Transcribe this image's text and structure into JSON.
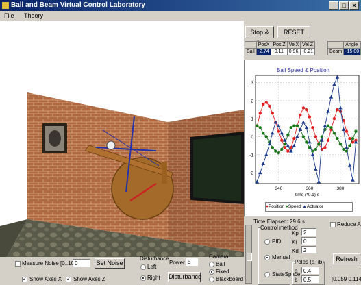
{
  "window": {
    "title": "Ball and Beam Virtual Control Laboratory"
  },
  "menu": {
    "file": "File",
    "theory": "Theory"
  },
  "top_buttons": {
    "stop_go": "Stop & Go",
    "reset": "RESET"
  },
  "state_table": {
    "headers": [
      "PosX",
      "Pos Z",
      "VelX",
      "Vel Z"
    ],
    "row_label": "Ball",
    "values": [
      "-2.74",
      "-0.11",
      "0.96",
      "-0.21"
    ],
    "angle_header": "Angle",
    "angle_row_label": "Beam",
    "angle_value": "-15.00"
  },
  "chart_data": {
    "type": "line",
    "title": "Ball Speed & Position",
    "xlabel": "time (*0.1) s",
    "x_ticks": [
      "340",
      "360",
      "380"
    ],
    "y_ticks": [
      "3",
      "2",
      "1",
      "0",
      "-1",
      "-2"
    ],
    "ylim": [
      -2.6,
      3.4
    ],
    "xlim": [
      325,
      392
    ],
    "legend": [
      "Position",
      "Speed",
      "Actuator"
    ],
    "series": [
      {
        "name": "Position",
        "color": "#e02020",
        "marker": "circle",
        "x": [
          326,
          328,
          330,
          332,
          334,
          336,
          338,
          340,
          342,
          344,
          346,
          348,
          350,
          352,
          354,
          356,
          358,
          360,
          362,
          364,
          366,
          368,
          370,
          372,
          374,
          376,
          378,
          380,
          382,
          384,
          386,
          388,
          390
        ],
        "y": [
          0.6,
          1.3,
          1.8,
          1.9,
          1.7,
          1.3,
          0.8,
          0.3,
          -0.2,
          -0.6,
          -0.8,
          -0.6,
          -0.1,
          0.6,
          1.2,
          1.6,
          1.5,
          1.1,
          0.5,
          0,
          -0.4,
          -0.7,
          -0.6,
          -0.2,
          0.4,
          1.0,
          1.5,
          1.4,
          0.9,
          0.3,
          -0.1,
          -0.3,
          -0.2
        ]
      },
      {
        "name": "Speed",
        "color": "#1a7a1a",
        "marker": "circle",
        "x": [
          326,
          328,
          330,
          332,
          334,
          336,
          338,
          340,
          342,
          344,
          346,
          348,
          350,
          352,
          354,
          356,
          358,
          360,
          362,
          364,
          366,
          368,
          370,
          372,
          374,
          376,
          378,
          380,
          382,
          384,
          386,
          388,
          390
        ],
        "y": [
          0.6,
          0.5,
          0.2,
          0,
          -0.3,
          -0.6,
          -0.8,
          -0.9,
          -0.7,
          -0.4,
          0.1,
          0.5,
          0.6,
          0.6,
          0.4,
          0,
          -0.3,
          -0.6,
          -0.8,
          -0.7,
          -0.4,
          0,
          0.4,
          0.6,
          0.5,
          0.2,
          -0.1,
          -0.4,
          -0.7,
          -0.8,
          -0.5,
          -0.1,
          0.3
        ]
      },
      {
        "name": "Actuator",
        "color": "#1a3a8a",
        "marker": "triangle",
        "x": [
          326,
          328,
          330,
          332,
          334,
          336,
          338,
          340,
          342,
          344,
          346,
          348,
          350,
          352,
          354,
          356,
          358,
          360,
          362,
          364,
          366,
          368,
          370,
          372,
          374,
          376,
          378,
          380,
          382,
          384,
          386,
          388,
          390
        ],
        "y": [
          -2.5,
          -2,
          -1.5,
          -1,
          -0.4,
          0.2,
          0.8,
          0.6,
          0.2,
          -0.2,
          -0.5,
          -0.8,
          -0.5,
          0,
          0.4,
          0.8,
          0.5,
          -0.3,
          -1,
          -1.8,
          -2.5,
          -0.2,
          0.6,
          1.4,
          2.2,
          2.9,
          3.3,
          1.6,
          0.4,
          -0.6,
          -1.6,
          -2.4,
          -0.3
        ]
      }
    ]
  },
  "time_elapsed": "Time Elapsed: 29.6 s",
  "reduce_label": "Reduce Ac",
  "control_method": {
    "title": "Control method",
    "options": [
      "PID",
      "Manual",
      "StateSpace"
    ],
    "selected": "Manual"
  },
  "gains": {
    "kp_label": "Kp",
    "kp": "2",
    "ki_label": "Ki",
    "ki": "0",
    "kd_label": "Kd",
    "kd": "2"
  },
  "poles": {
    "title": "Poles (a+ib)",
    "a_label": "a",
    "a": "0.4",
    "b_label": "b",
    "b": "0.5"
  },
  "refresh_label": "Refresh",
  "range_readout": "[0.059 0.114",
  "noise": {
    "label": "Measure Noise [0..100]",
    "value": "0",
    "button": "Set Noise"
  },
  "disturbance": {
    "title": "Disturbance",
    "left": "Left",
    "right": "Right",
    "selected": "Right",
    "button": "Disturbance",
    "power_label": "Power",
    "power": "5"
  },
  "camera": {
    "title": "Camera",
    "options": [
      "Ball",
      "Fixed",
      "Blackboard"
    ],
    "selected": "Fixed"
  },
  "axes": {
    "show_x": "Show Axes X",
    "show_z": "Show Axes Z"
  }
}
